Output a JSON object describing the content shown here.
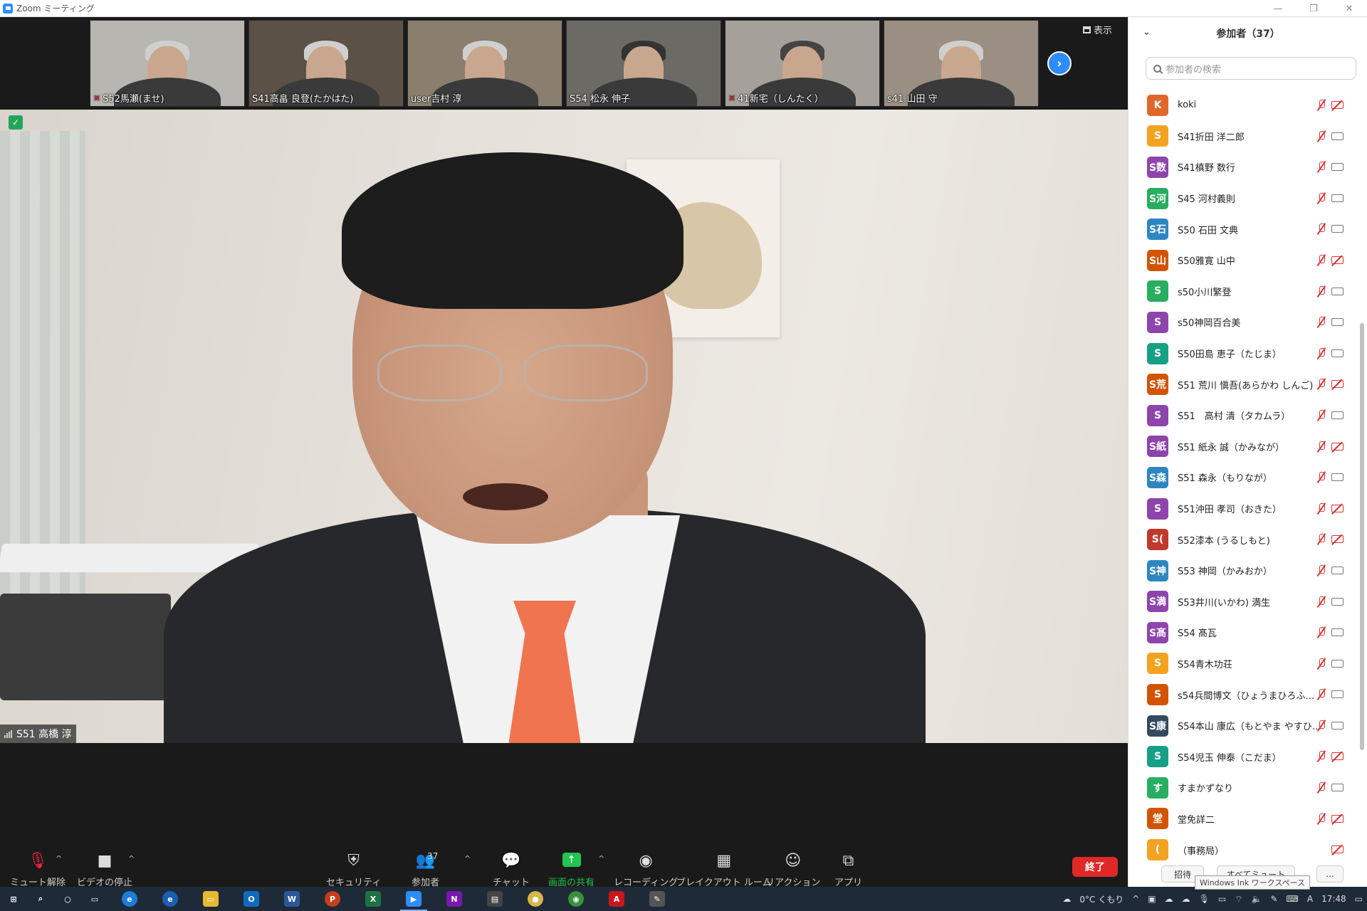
{
  "window": {
    "title": "Zoom ミーティング",
    "controls": [
      "—",
      "❐",
      "✕"
    ]
  },
  "gallery": {
    "view_label": "表示",
    "tiles": [
      {
        "name": "S52馬瀬(ませ)",
        "muted": true,
        "bg": "#b8b6b0"
      },
      {
        "name": "S41高畠 良登(たかはた)",
        "muted": false,
        "bg": "#5b5147"
      },
      {
        "name": "user吉村 淳",
        "muted": false,
        "bg": "#8a7e6e"
      },
      {
        "name": "S54 松永 伸子",
        "muted": false,
        "bg": "#6c6a64"
      },
      {
        "name": "41新宅（しんたく）",
        "muted": true,
        "bg": "#a6a09a"
      },
      {
        "name": "s41 山田 守",
        "muted": false,
        "bg": "#9a8f82"
      }
    ]
  },
  "main_video": {
    "speaker": "S51 高橋 淳"
  },
  "toolbar": {
    "unmute": "ミュート解除",
    "stop_video": "ビデオの停止",
    "security": "セキュリティ",
    "participants": "参加者",
    "participants_count": "37",
    "chat": "チャット",
    "share": "画面の共有",
    "record": "レコーディング",
    "breakout": "ブレイクアウト ルーム",
    "reactions": "リアクション",
    "apps": "アプリ",
    "end": "終了"
  },
  "panel": {
    "title": "参加者（37）",
    "search_placeholder": "参加者の検索",
    "participants": [
      {
        "initial": "K",
        "name": "koki",
        "color": "#e0672b",
        "cam_off": true,
        "mic": true
      },
      {
        "initial": "S",
        "name": "S41折田 洋二郎",
        "color": "#f4a321",
        "cam_off": false,
        "mic": true
      },
      {
        "initial": "S数",
        "name": "S41槙野 数行",
        "color": "#8e44ad",
        "cam_off": false,
        "mic": true
      },
      {
        "initial": "S河",
        "name": "S45 河村義則",
        "color": "#27ae60",
        "cam_off": false,
        "mic": true
      },
      {
        "initial": "S石",
        "name": "S50 石田 文典",
        "color": "#2e86c1",
        "cam_off": false,
        "mic": true
      },
      {
        "initial": "S山",
        "name": "S50雅寛 山中",
        "color": "#d35400",
        "cam_off": true,
        "mic": true
      },
      {
        "initial": "S",
        "name": "s50小川繁登",
        "color": "#27ae60",
        "cam_off": false,
        "mic": true
      },
      {
        "initial": "S",
        "name": "s50神岡百合美",
        "color": "#8e44ad",
        "cam_off": false,
        "mic": true
      },
      {
        "initial": "S",
        "name": "S50田島 恵子（たじま）",
        "color": "#16a085",
        "cam_off": false,
        "mic": true
      },
      {
        "initial": "S荒",
        "name": "S51 荒川 愼吾(あらかわ しんご)",
        "color": "#d35400",
        "cam_off": true,
        "mic": true
      },
      {
        "initial": "S",
        "name": "S51　高村 清（タカムラ）",
        "color": "#8e44ad",
        "cam_off": false,
        "mic": true
      },
      {
        "initial": "S紙",
        "name": "S51 紙永 誠（かみなが）",
        "color": "#8e44ad",
        "cam_off": true,
        "mic": true
      },
      {
        "initial": "S森",
        "name": "S51 森永（もりなが）",
        "color": "#2e86c1",
        "cam_off": false,
        "mic": true
      },
      {
        "initial": "S",
        "name": "S51沖田 孝司（おきた）",
        "color": "#8e44ad",
        "cam_off": true,
        "mic": true
      },
      {
        "initial": "S(",
        "name": "S52漆本 (うるしもと)",
        "color": "#c0392b",
        "cam_off": true,
        "mic": true
      },
      {
        "initial": "S神",
        "name": "S53 神岡（かみおか）",
        "color": "#2e86c1",
        "cam_off": false,
        "mic": true
      },
      {
        "initial": "S満",
        "name": "S53井川(いかわ) 満生",
        "color": "#8e44ad",
        "cam_off": false,
        "mic": true
      },
      {
        "initial": "S髙",
        "name": "S54 髙瓦",
        "color": "#8e44ad",
        "cam_off": false,
        "mic": true
      },
      {
        "initial": "S",
        "name": "S54青木功荘",
        "color": "#f4a321",
        "cam_off": false,
        "mic": true
      },
      {
        "initial": "S",
        "name": "s54兵間博文（ひょうまひろふみ）",
        "color": "#d35400",
        "cam_off": false,
        "mic": true
      },
      {
        "initial": "S康",
        "name": "S54本山 康広（もとやま やすひろ...",
        "color": "#34495e",
        "cam_off": false,
        "mic": true
      },
      {
        "initial": "S",
        "name": "S54児玉 伸泰（こだま）",
        "color": "#16a085",
        "cam_off": true,
        "mic": true
      },
      {
        "initial": "す",
        "name": "すまかずなり",
        "color": "#27ae60",
        "cam_off": false,
        "mic": true
      },
      {
        "initial": "堂",
        "name": "堂免詳二",
        "color": "#d35400",
        "cam_off": true,
        "mic": true
      },
      {
        "initial": "(",
        "name": "（事務局）",
        "color": "#f4a321",
        "cam_off": true,
        "mic": false
      }
    ],
    "invite": "招待",
    "mute_all": "すべてミュート",
    "more": "...",
    "tooltip": "Windows Ink ワークスペース"
  },
  "taskbar": {
    "weather": "0°C くもり",
    "time": "17:48",
    "ime": "A"
  }
}
